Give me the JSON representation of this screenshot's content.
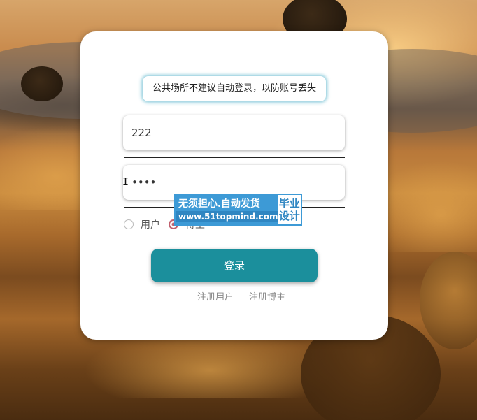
{
  "login": {
    "notice": "公共场所不建议自动登录，以防账号丢失",
    "username_value": "222",
    "password_masked": "••••",
    "roles": [
      "用户",
      "博主"
    ],
    "selected_role": "博主",
    "submit_label": "登录",
    "links": [
      "注册用户",
      "注册博主"
    ]
  },
  "watermark": {
    "title": "无须担心.自动发货",
    "url": "www.51topmind.com",
    "badge": "毕业\n设计"
  },
  "colors": {
    "primary": "#1b8f9c",
    "watermark_blue": "#3d9ad6"
  }
}
